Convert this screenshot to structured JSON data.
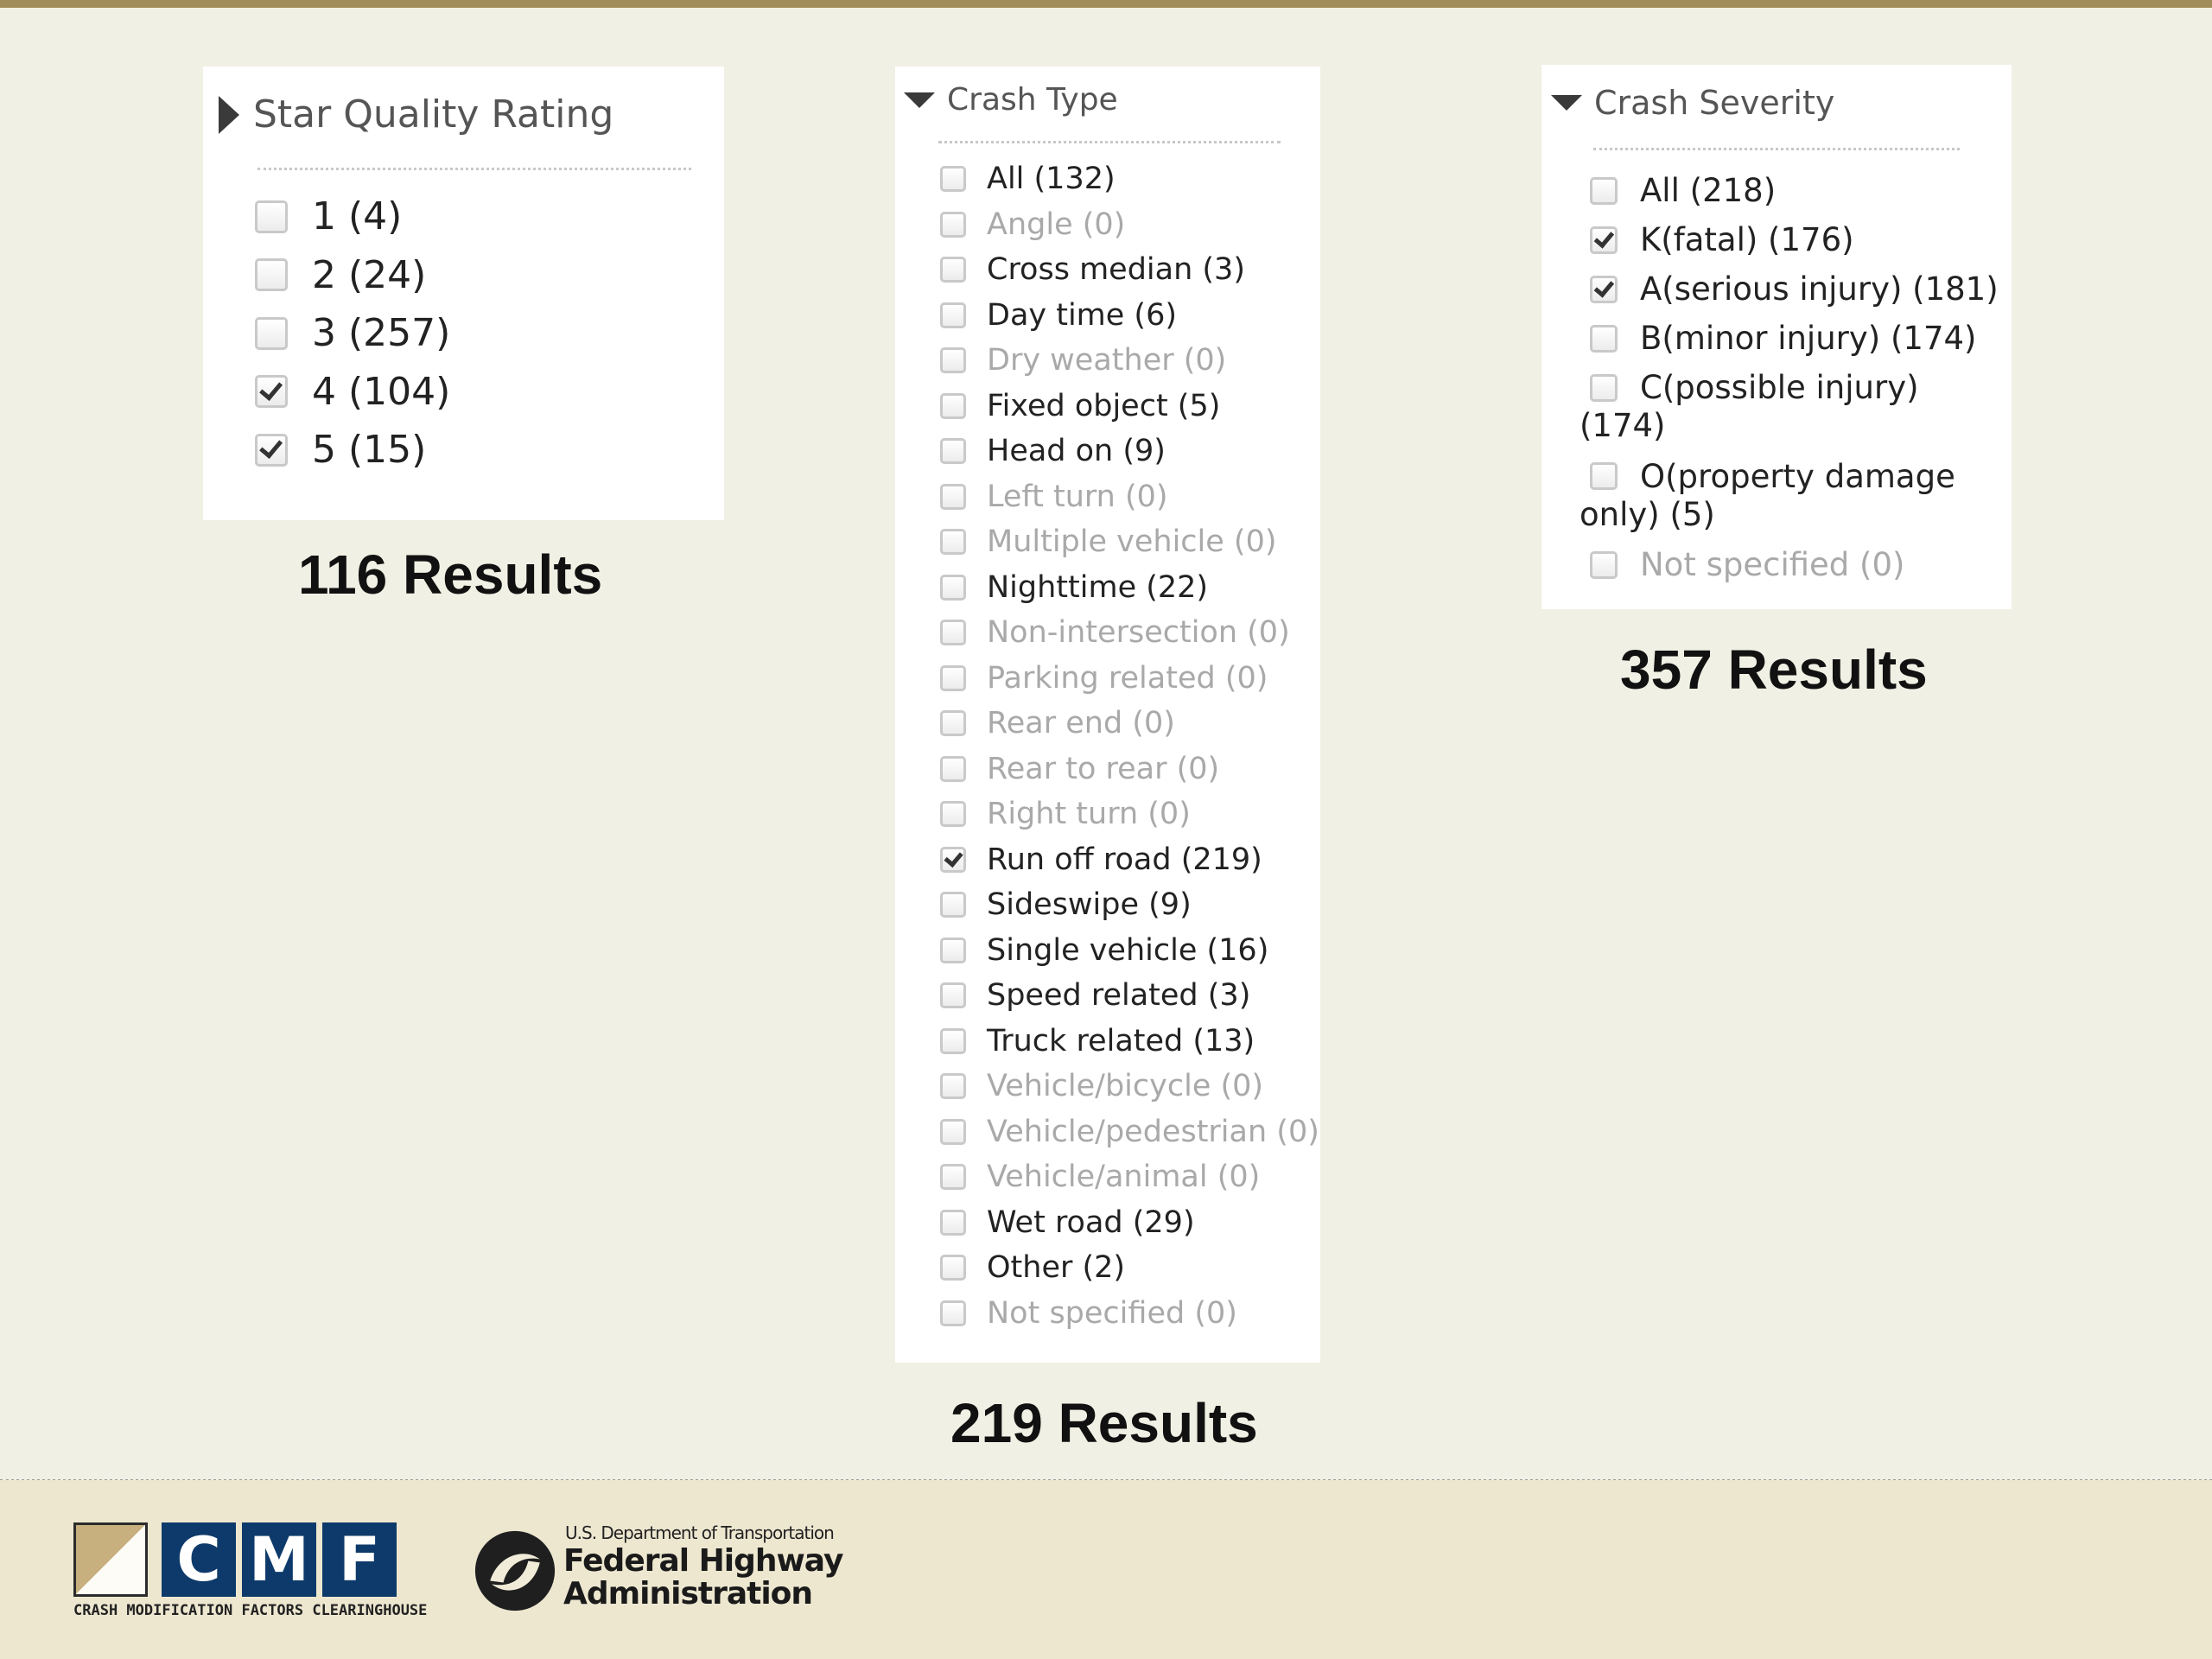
{
  "star_panel": {
    "title": "Star Quality Rating",
    "options": [
      {
        "label": "1 (4)",
        "checked": false
      },
      {
        "label": "2 (24)",
        "checked": false
      },
      {
        "label": "3 (257)",
        "checked": false
      },
      {
        "label": "4 (104)",
        "checked": true
      },
      {
        "label": "5 (15)",
        "checked": true
      }
    ],
    "results": "116 Results"
  },
  "crash_type_panel": {
    "title": "Crash Type",
    "options": [
      {
        "label": "All (132)",
        "checked": false,
        "dim": false
      },
      {
        "label": "Angle (0)",
        "checked": false,
        "dim": true
      },
      {
        "label": "Cross median (3)",
        "checked": false,
        "dim": false
      },
      {
        "label": "Day time (6)",
        "checked": false,
        "dim": false
      },
      {
        "label": "Dry weather (0)",
        "checked": false,
        "dim": true
      },
      {
        "label": "Fixed object (5)",
        "checked": false,
        "dim": false
      },
      {
        "label": "Head on (9)",
        "checked": false,
        "dim": false
      },
      {
        "label": "Left turn (0)",
        "checked": false,
        "dim": true
      },
      {
        "label": "Multiple vehicle (0)",
        "checked": false,
        "dim": true
      },
      {
        "label": "Nighttime (22)",
        "checked": false,
        "dim": false
      },
      {
        "label": "Non-intersection (0)",
        "checked": false,
        "dim": true
      },
      {
        "label": "Parking related (0)",
        "checked": false,
        "dim": true
      },
      {
        "label": "Rear end (0)",
        "checked": false,
        "dim": true
      },
      {
        "label": "Rear to rear (0)",
        "checked": false,
        "dim": true
      },
      {
        "label": "Right turn (0)",
        "checked": false,
        "dim": true
      },
      {
        "label": "Run off road (219)",
        "checked": true,
        "dim": false
      },
      {
        "label": "Sideswipe (9)",
        "checked": false,
        "dim": false
      },
      {
        "label": "Single vehicle (16)",
        "checked": false,
        "dim": false
      },
      {
        "label": "Speed related (3)",
        "checked": false,
        "dim": false
      },
      {
        "label": "Truck related (13)",
        "checked": false,
        "dim": false
      },
      {
        "label": "Vehicle/bicycle (0)",
        "checked": false,
        "dim": true
      },
      {
        "label": "Vehicle/pedestrian (0)",
        "checked": false,
        "dim": true
      },
      {
        "label": "Vehicle/animal (0)",
        "checked": false,
        "dim": true
      },
      {
        "label": "Wet road (29)",
        "checked": false,
        "dim": false
      },
      {
        "label": "Other (2)",
        "checked": false,
        "dim": false
      },
      {
        "label": "Not specified (0)",
        "checked": false,
        "dim": true
      }
    ],
    "results": "219 Results"
  },
  "severity_panel": {
    "title": "Crash Severity",
    "options": [
      {
        "label": "All (218)",
        "label2": "",
        "checked": false,
        "dim": false
      },
      {
        "label": "K(fatal) (176)",
        "label2": "",
        "checked": true,
        "dim": false
      },
      {
        "label": "A(serious injury) (181)",
        "label2": "",
        "checked": true,
        "dim": false
      },
      {
        "label": "B(minor injury) (174)",
        "label2": "",
        "checked": false,
        "dim": false
      },
      {
        "label": "C(possible injury)",
        "label2": "(174)",
        "checked": false,
        "dim": false
      },
      {
        "label": "O(property damage",
        "label2": "only) (5)",
        "checked": false,
        "dim": false
      },
      {
        "label": "Not specified (0)",
        "label2": "",
        "checked": false,
        "dim": true
      }
    ],
    "results": "357 Results"
  },
  "footer": {
    "cmf_letters": [
      "C",
      "M",
      "F"
    ],
    "cmf_subtitle": "CRASH MODIFICATION FACTORS CLEARINGHOUSE",
    "dot_line": "U.S. Department of Transportation",
    "fhwa_line1": "Federal Highway",
    "fhwa_line2": "Administration"
  }
}
